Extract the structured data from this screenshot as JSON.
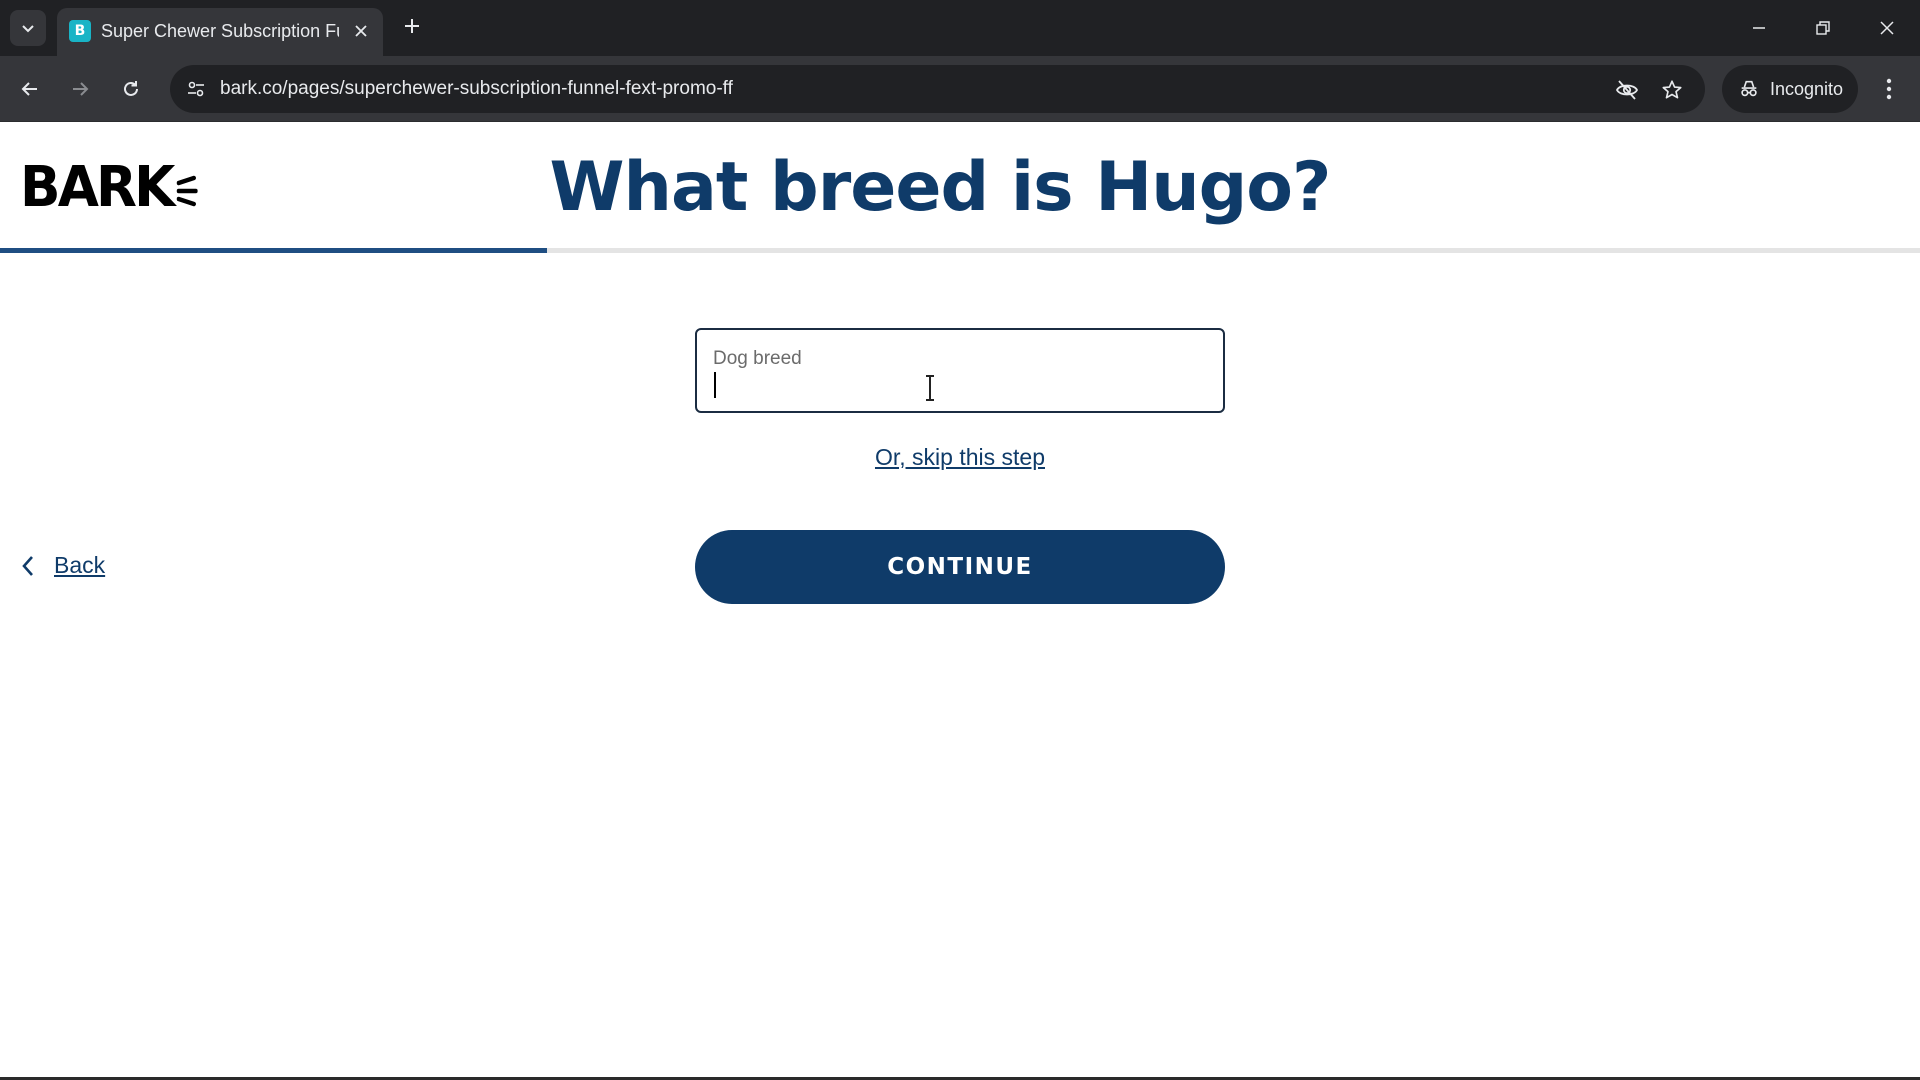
{
  "browser": {
    "tab_title": "Super Chewer Subscription Fun",
    "url": "bark.co/pages/superchewer-subscription-funnel-fext-promo-ff",
    "incognito_label": "Incognito"
  },
  "page": {
    "logo_text": "BARK",
    "heading": "What breed is Hugo?",
    "progress_fraction": 0.285,
    "breed_field": {
      "label": "Dog breed",
      "value": ""
    },
    "skip_link": "Or, skip this step",
    "back_label": "Back",
    "continue_label": "CONTINUE"
  },
  "colors": {
    "brand_navy": "#0f3b69",
    "progress_fill": "#1f4e82",
    "chrome_dark": "#202124",
    "chrome_toolbar": "#35363a"
  }
}
